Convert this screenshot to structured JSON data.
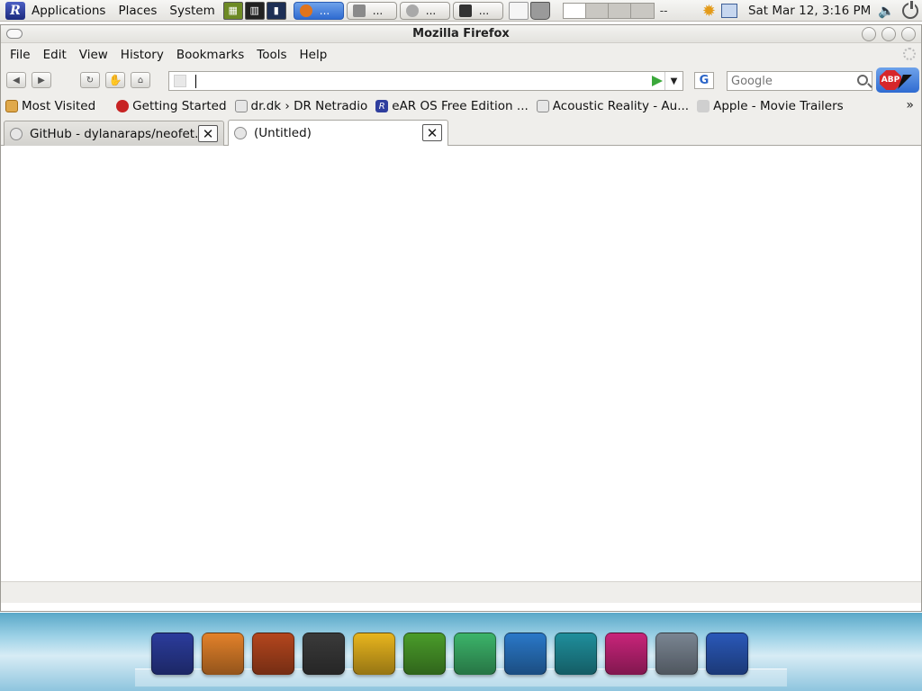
{
  "panel": {
    "menus": [
      "Applications",
      "Places",
      "System"
    ],
    "task_buttons": [
      {
        "label": "...",
        "active": true,
        "icon": "firefox-icon"
      },
      {
        "label": "...",
        "active": false,
        "icon": "screenshot-icon"
      },
      {
        "label": "...",
        "active": false,
        "icon": "weather-icon"
      },
      {
        "label": "...",
        "active": false,
        "icon": "terminal-icon"
      }
    ],
    "workspace_suffix": "--",
    "clock": "Sat Mar 12,  3:16 PM"
  },
  "window": {
    "title": "Mozilla Firefox"
  },
  "menubar": [
    "File",
    "Edit",
    "View",
    "History",
    "Bookmarks",
    "Tools",
    "Help"
  ],
  "navbar": {
    "url_value": "",
    "search_engine_letter": "G",
    "search_placeholder": "Google",
    "adblock_label": "ABP"
  },
  "bookmarks": [
    "Most Visited",
    "Getting Started",
    "dr.dk › DR Netradio",
    "eAR OS Free Edition ...",
    "Acoustic Reality - Au...",
    "Apple - Movie Trailers"
  ],
  "bookmarks_more": "»",
  "tabs": [
    {
      "label": "GitHub - dylanaraps/neofet...",
      "selected": false
    },
    {
      "label": "(Untitled)",
      "selected": true
    }
  ],
  "dock": [
    {
      "name": "ear-os-icon",
      "color": "#2b3c9c"
    },
    {
      "name": "browser-icon",
      "color": "#e3822a"
    },
    {
      "name": "guitar-icon",
      "color": "#b4461e"
    },
    {
      "name": "burn-disc-icon",
      "color": "#3a3a3a"
    },
    {
      "name": "coffee-icon",
      "color": "#e8b51e"
    },
    {
      "name": "photo-icon",
      "color": "#4a9c2a"
    },
    {
      "name": "messenger-icon",
      "color": "#3cb46a"
    },
    {
      "name": "office-icon",
      "color": "#2a78c8"
    },
    {
      "name": "feather-icon",
      "color": "#1f8f9c"
    },
    {
      "name": "music-icon",
      "color": "#c8247a"
    },
    {
      "name": "settings-icon",
      "color": "#7a8592"
    },
    {
      "name": "shutdown-icon",
      "color": "#2a58b8"
    }
  ]
}
